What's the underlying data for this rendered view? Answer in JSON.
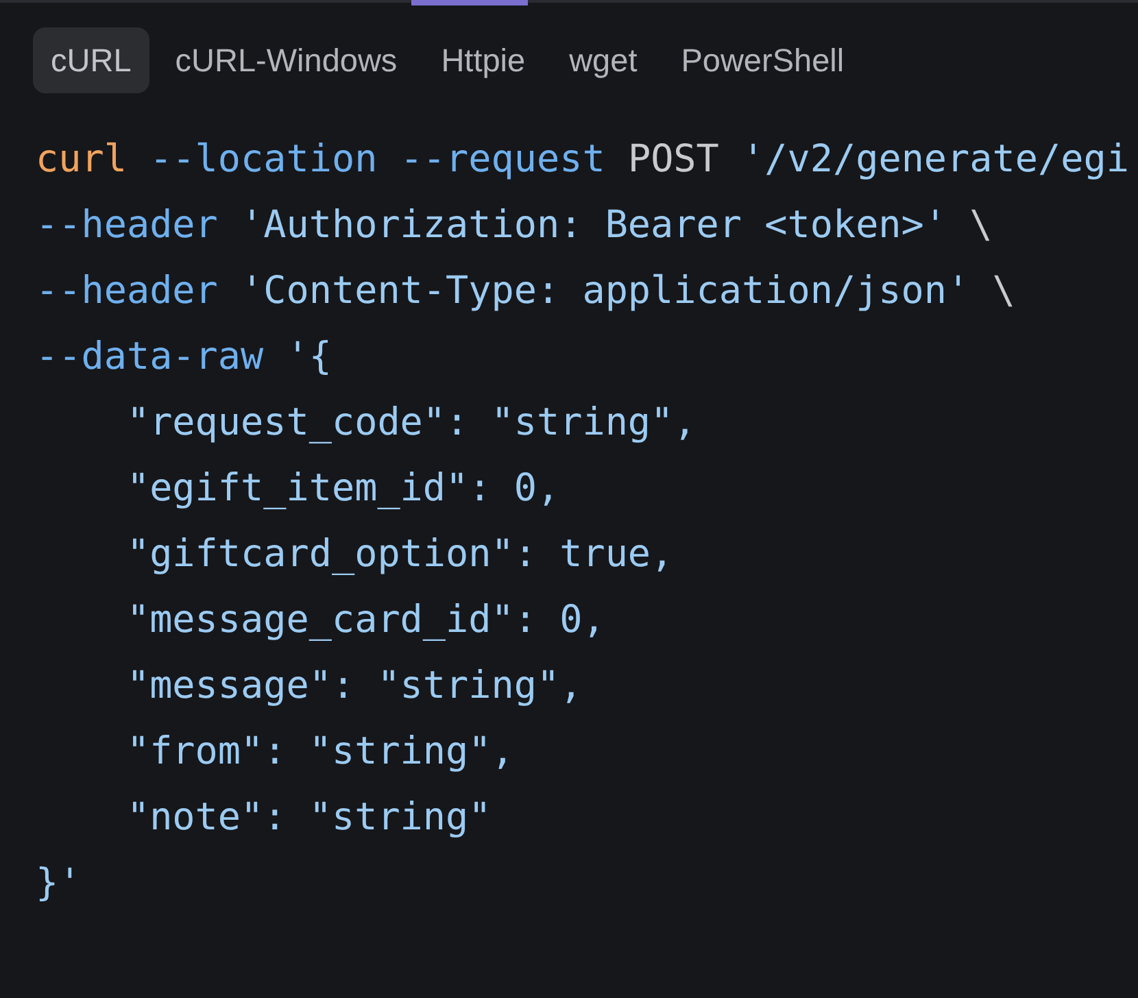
{
  "tabs": [
    {
      "label": "cURL",
      "selected": true
    },
    {
      "label": "cURL-Windows",
      "selected": false
    },
    {
      "label": "Httpie",
      "selected": false
    },
    {
      "label": "wget",
      "selected": false
    },
    {
      "label": "PowerShell",
      "selected": false
    }
  ],
  "code_lines": [
    [
      {
        "kind": "command",
        "text": "curl"
      },
      {
        "kind": "flag",
        "text": " --location"
      },
      {
        "kind": "flag",
        "text": " --request"
      },
      {
        "kind": "plain",
        "text": " POST "
      },
      {
        "kind": "string",
        "text": "'/v2/generate/egi"
      }
    ],
    [
      {
        "kind": "flag",
        "text": "--header"
      },
      {
        "kind": "string",
        "text": " 'Authorization: Bearer <token>'"
      },
      {
        "kind": "plain",
        "text": " \\"
      }
    ],
    [
      {
        "kind": "flag",
        "text": "--header"
      },
      {
        "kind": "string",
        "text": " 'Content-Type: application/json'"
      },
      {
        "kind": "plain",
        "text": " \\"
      }
    ],
    [
      {
        "kind": "flag",
        "text": "--data-raw"
      },
      {
        "kind": "string",
        "text": " '{"
      }
    ],
    [
      {
        "kind": "string",
        "text": "    \"request_code\": \"string\","
      }
    ],
    [
      {
        "kind": "string",
        "text": "    \"egift_item_id\": 0,"
      }
    ],
    [
      {
        "kind": "string",
        "text": "    \"giftcard_option\": true,"
      }
    ],
    [
      {
        "kind": "string",
        "text": "    \"message_card_id\": 0,"
      }
    ],
    [
      {
        "kind": "string",
        "text": "    \"message\": \"string\","
      }
    ],
    [
      {
        "kind": "string",
        "text": "    \"from\": \"string\","
      }
    ],
    [
      {
        "kind": "string",
        "text": "    \"note\": \"string\""
      }
    ],
    [
      {
        "kind": "string",
        "text": "}'"
      }
    ]
  ]
}
